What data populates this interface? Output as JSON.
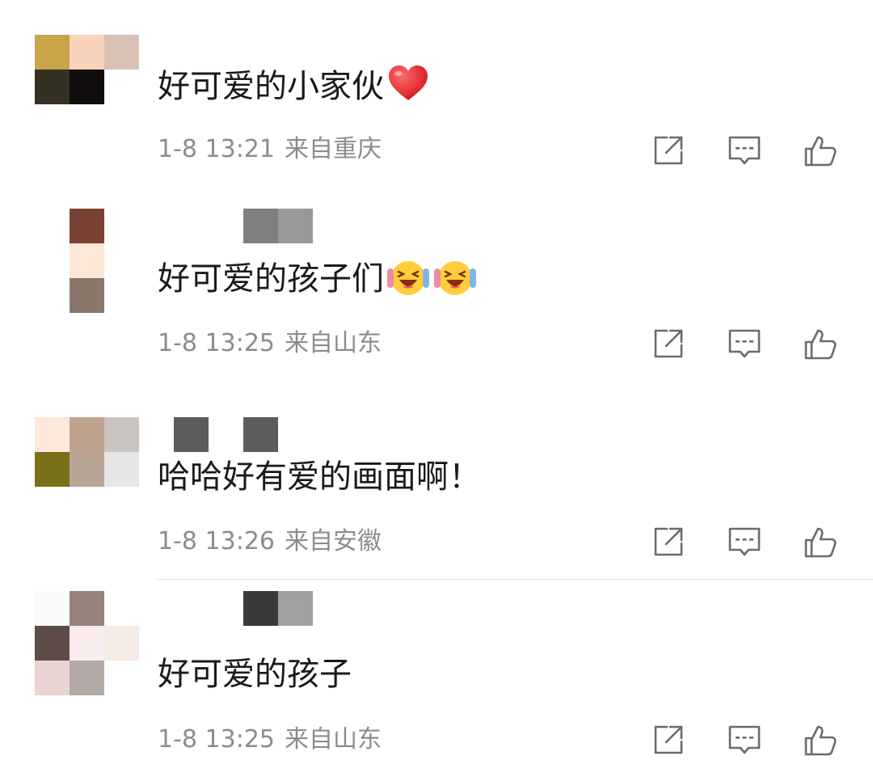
{
  "comments": [
    {
      "text": "好可爱的小家伙",
      "emoji": "heart",
      "time": "1-8 13:21",
      "location": "来自重庆",
      "avatar_colors": [
        "#c9a449",
        "#f8d3bb",
        "#dac1b5",
        "#343022",
        "#110d0c",
        "#ffffff",
        "#ffffff",
        "#ffffff",
        "#ffffff"
      ]
    },
    {
      "text": "好可爱的孩子们",
      "emoji": "laughing-tears",
      "time": "1-8 13:25",
      "location": "来自山东",
      "avatar_colors": [
        "#ffffff",
        "#7a4233",
        "#ffffff",
        "#ffffff",
        "#fde7d7",
        "#ffffff",
        "#ffffff",
        "#8a776c",
        "#ffffff"
      ]
    },
    {
      "text": "哈哈好有爱的画面啊！",
      "emoji": "",
      "time": "1-8 13:26",
      "location": "来自安徽",
      "avatar_colors": [
        "#fde8da",
        "#c0a38f",
        "#c9c4bf",
        "#787118",
        "#b9a596",
        "#e6e6e6",
        "#ffffff",
        "#ffffff",
        "#ffffff"
      ]
    },
    {
      "text": "好可爱的孩子",
      "emoji": "",
      "time": "1-8 13:25",
      "location": "来自山东",
      "avatar_colors": [
        "#f9fbfb",
        "#958279",
        "#ffffff",
        "#5d4d46",
        "#f9ecec",
        "#f5ebe4",
        "#e9d4d3",
        "#b2a9a7",
        "#ffffff"
      ]
    }
  ],
  "icons": {
    "share": "share-icon",
    "reply": "comment-icon",
    "like": "thumbs-up-icon"
  },
  "colors": {
    "meta_text": "#8c8c8c",
    "icon_stroke": "#6b6b6b",
    "divider": "#e6e6e6"
  }
}
